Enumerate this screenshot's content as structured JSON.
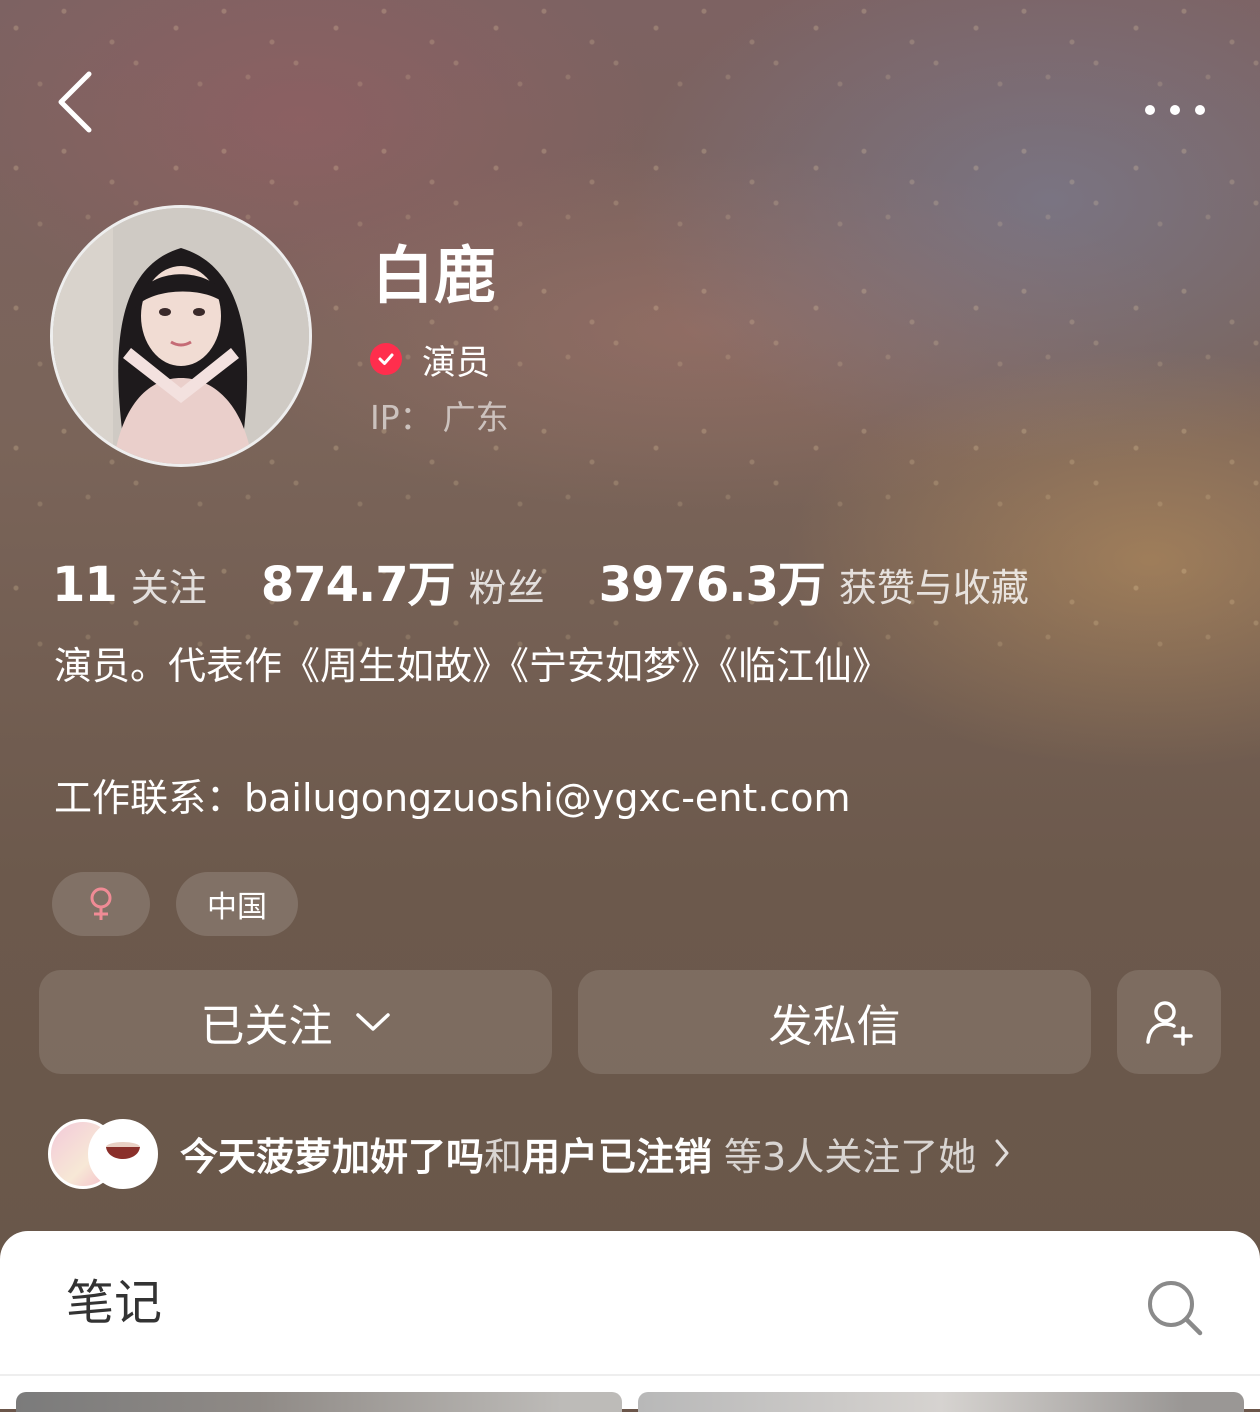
{
  "header": {
    "back_icon": "chevron-left-icon",
    "more_icon": "more-dots-icon"
  },
  "profile": {
    "name": "白鹿",
    "verified_icon": "verified-check-icon",
    "verified_color": "#ff2e4d",
    "title": "演员",
    "ip_label": "IP：",
    "ip_value": "广东"
  },
  "stats": [
    {
      "value": "11",
      "label": "关注"
    },
    {
      "value": "874.7万",
      "label": "粉丝"
    },
    {
      "value": "3976.3万",
      "label": "获赞与收藏"
    }
  ],
  "bio": {
    "text": "演员。代表作《周生如故》《宁安如梦》《临江仙》",
    "contact": "工作联系：bailugongzuoshi@ygxc-ent.com"
  },
  "tags": {
    "gender_icon": "female-icon",
    "gender_color": "#f08b95",
    "country": "中国"
  },
  "actions": {
    "followed_label": "已关注",
    "message_label": "发私信",
    "add_friend_icon": "add-user-icon"
  },
  "mutual": {
    "user1": "今天菠萝加妍了吗",
    "connector": "和",
    "user2": "用户已注销",
    "suffix": "等3人关注了她"
  },
  "notes_section": {
    "title": "笔记",
    "search_icon": "search-icon"
  }
}
